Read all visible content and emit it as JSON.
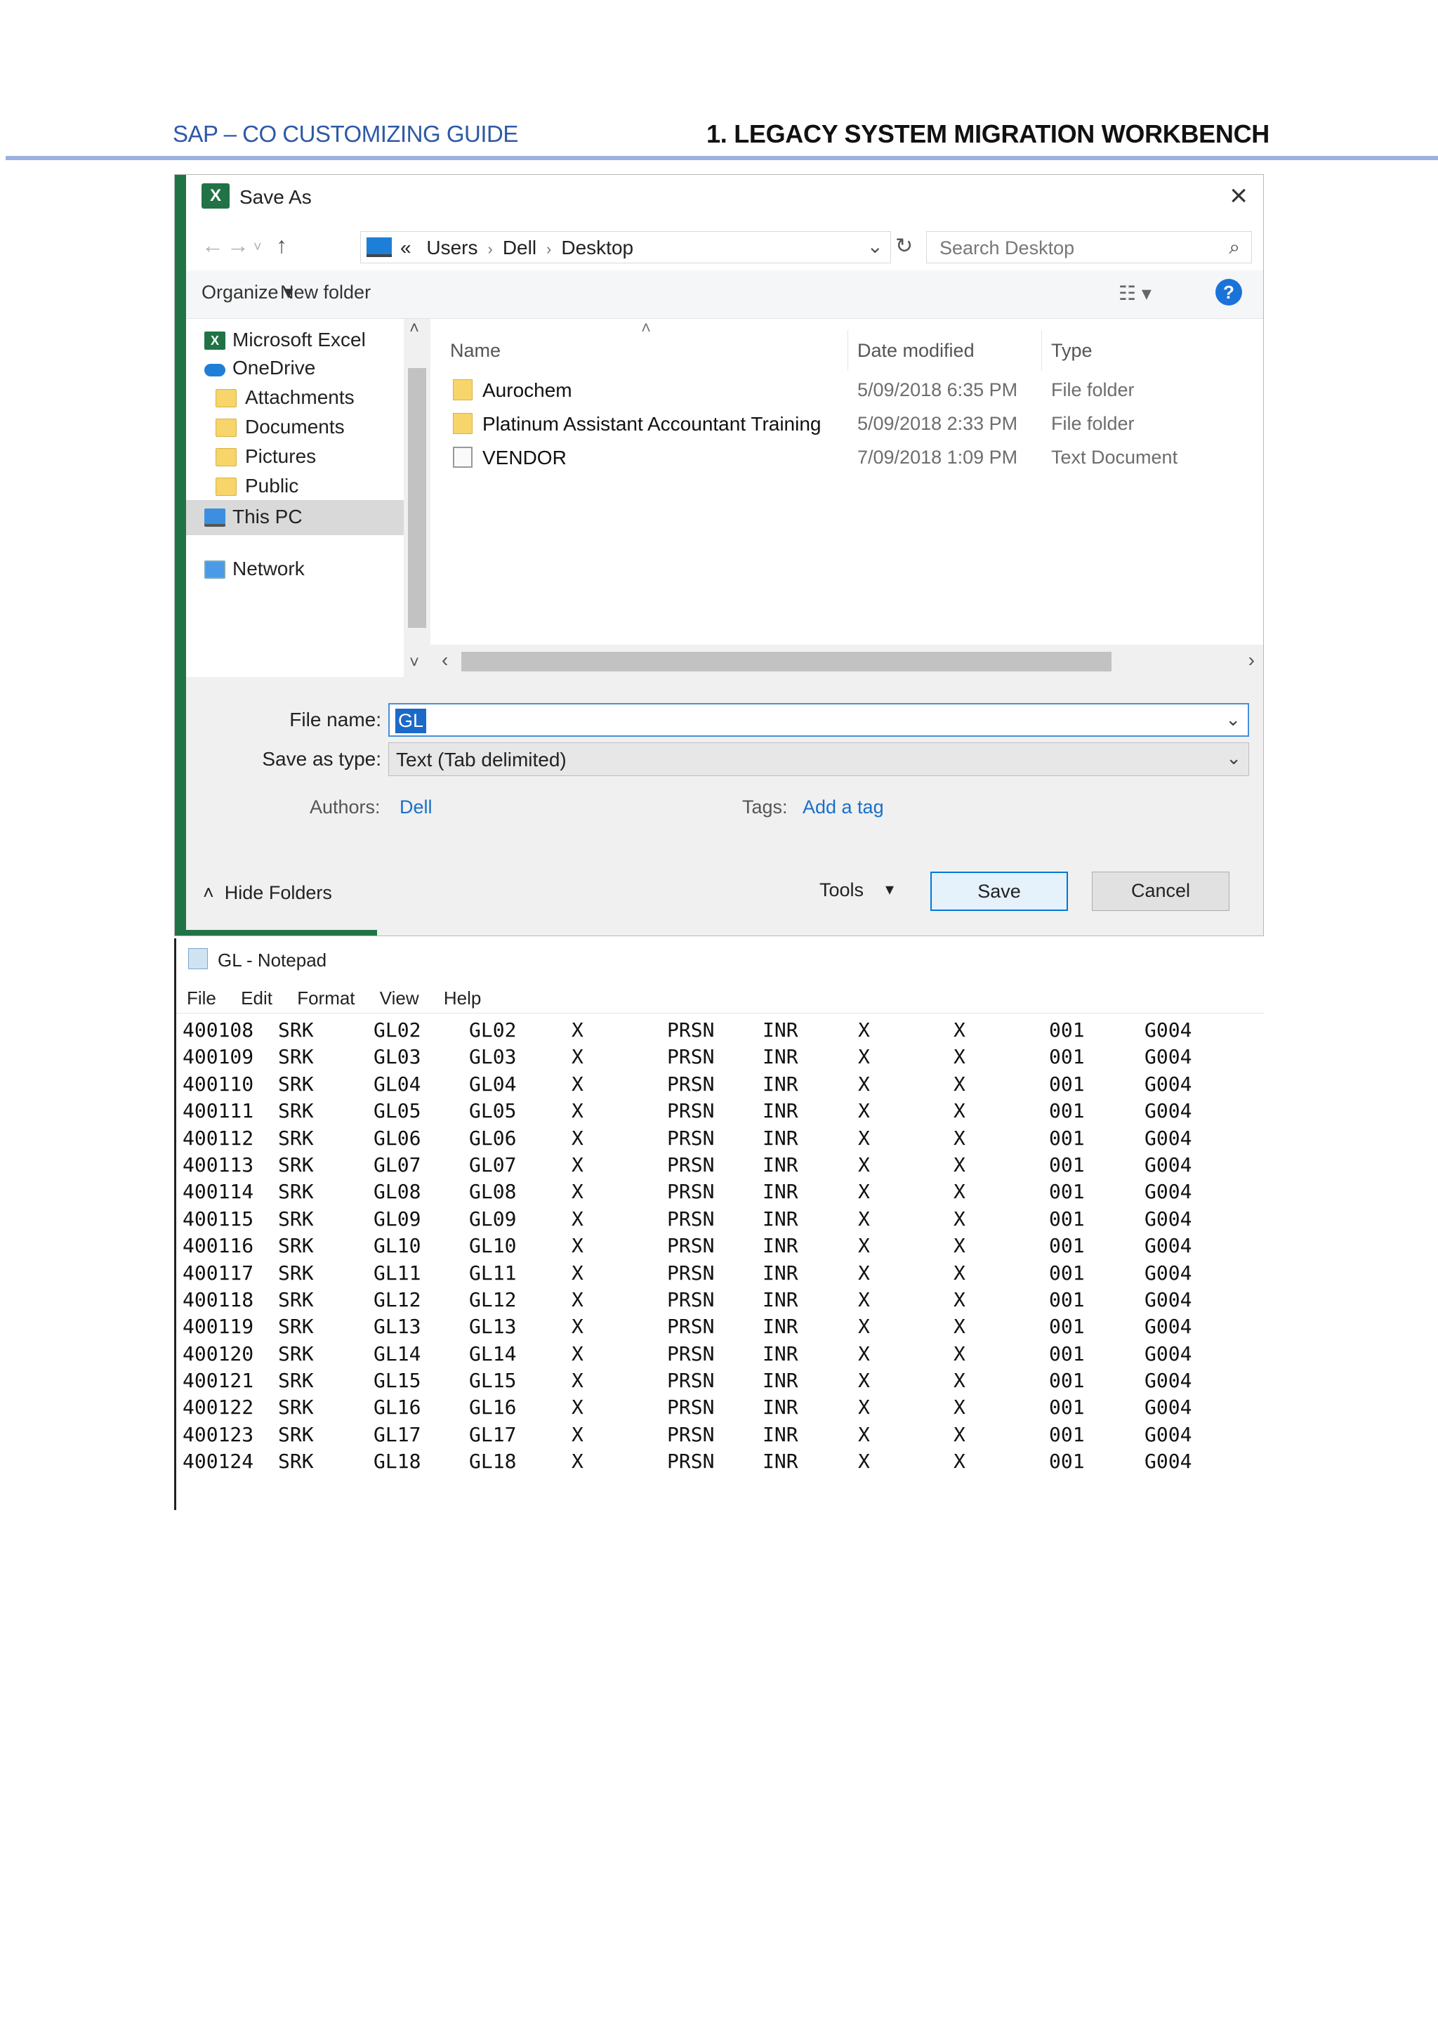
{
  "doc_header": {
    "left": "SAP – CO CUSTOMIZING GUIDE",
    "right": "1. LEGACY SYSTEM MIGRATION WORKBENCH"
  },
  "dialog": {
    "title": "Save As",
    "breadcrumb": [
      "«",
      "Users",
      "Dell",
      "Desktop"
    ],
    "search_placeholder": "Search Desktop",
    "toolbar": {
      "organize": "Organize ▾",
      "new_folder": "New folder"
    },
    "nav_items": [
      {
        "label": "Microsoft Excel",
        "icon": "excel-icon"
      },
      {
        "label": "OneDrive",
        "icon": "onedrive-icon"
      },
      {
        "label": "Attachments",
        "icon": "folder-icon"
      },
      {
        "label": "Documents",
        "icon": "folder-icon"
      },
      {
        "label": "Pictures",
        "icon": "folder-icon"
      },
      {
        "label": "Public",
        "icon": "folder-icon"
      },
      {
        "label": "This PC",
        "icon": "this-pc-icon",
        "selected": true
      },
      {
        "label": "Network",
        "icon": "network-icon"
      }
    ],
    "columns": {
      "name": "Name",
      "date": "Date modified",
      "type": "Type"
    },
    "files": [
      {
        "name": "Aurochem",
        "date": "5/09/2018 6:35 PM",
        "type": "File folder",
        "icon": "folder-icon"
      },
      {
        "name": "Platinum Assistant Accountant Training",
        "date": "5/09/2018 2:33 PM",
        "type": "File folder",
        "icon": "folder-icon"
      },
      {
        "name": "VENDOR",
        "date": "7/09/2018 1:09 PM",
        "type": "Text Document",
        "icon": "text-document-icon"
      }
    ],
    "file_name_label": "File name:",
    "file_name_value": "GL",
    "save_type_label": "Save as type:",
    "save_type_value": "Text (Tab delimited)",
    "authors_label": "Authors:",
    "authors_value": "Dell",
    "tags_label": "Tags:",
    "tags_value": "Add a tag",
    "hide_folders": "Hide Folders",
    "tools": "Tools",
    "save": "Save",
    "cancel": "Cancel"
  },
  "notepad": {
    "title": "GL - Notepad",
    "menu": [
      "File",
      "Edit",
      "Format",
      "View",
      "Help"
    ],
    "rows": [
      [
        "400108",
        "SRK",
        "GL02",
        "GL02",
        "X",
        "PRSN",
        "INR",
        "X",
        "X",
        "001",
        "G004"
      ],
      [
        "400109",
        "SRK",
        "GL03",
        "GL03",
        "X",
        "PRSN",
        "INR",
        "X",
        "X",
        "001",
        "G004"
      ],
      [
        "400110",
        "SRK",
        "GL04",
        "GL04",
        "X",
        "PRSN",
        "INR",
        "X",
        "X",
        "001",
        "G004"
      ],
      [
        "400111",
        "SRK",
        "GL05",
        "GL05",
        "X",
        "PRSN",
        "INR",
        "X",
        "X",
        "001",
        "G004"
      ],
      [
        "400112",
        "SRK",
        "GL06",
        "GL06",
        "X",
        "PRSN",
        "INR",
        "X",
        "X",
        "001",
        "G004"
      ],
      [
        "400113",
        "SRK",
        "GL07",
        "GL07",
        "X",
        "PRSN",
        "INR",
        "X",
        "X",
        "001",
        "G004"
      ],
      [
        "400114",
        "SRK",
        "GL08",
        "GL08",
        "X",
        "PRSN",
        "INR",
        "X",
        "X",
        "001",
        "G004"
      ],
      [
        "400115",
        "SRK",
        "GL09",
        "GL09",
        "X",
        "PRSN",
        "INR",
        "X",
        "X",
        "001",
        "G004"
      ],
      [
        "400116",
        "SRK",
        "GL10",
        "GL10",
        "X",
        "PRSN",
        "INR",
        "X",
        "X",
        "001",
        "G004"
      ],
      [
        "400117",
        "SRK",
        "GL11",
        "GL11",
        "X",
        "PRSN",
        "INR",
        "X",
        "X",
        "001",
        "G004"
      ],
      [
        "400118",
        "SRK",
        "GL12",
        "GL12",
        "X",
        "PRSN",
        "INR",
        "X",
        "X",
        "001",
        "G004"
      ],
      [
        "400119",
        "SRK",
        "GL13",
        "GL13",
        "X",
        "PRSN",
        "INR",
        "X",
        "X",
        "001",
        "G004"
      ],
      [
        "400120",
        "SRK",
        "GL14",
        "GL14",
        "X",
        "PRSN",
        "INR",
        "X",
        "X",
        "001",
        "G004"
      ],
      [
        "400121",
        "SRK",
        "GL15",
        "GL15",
        "X",
        "PRSN",
        "INR",
        "X",
        "X",
        "001",
        "G004"
      ],
      [
        "400122",
        "SRK",
        "GL16",
        "GL16",
        "X",
        "PRSN",
        "INR",
        "X",
        "X",
        "001",
        "G004"
      ],
      [
        "400123",
        "SRK",
        "GL17",
        "GL17",
        "X",
        "PRSN",
        "INR",
        "X",
        "X",
        "001",
        "G004"
      ],
      [
        "400124",
        "SRK",
        "GL18",
        "GL18",
        "X",
        "PRSN",
        "INR",
        "X",
        "X",
        "001",
        "G004"
      ]
    ]
  }
}
